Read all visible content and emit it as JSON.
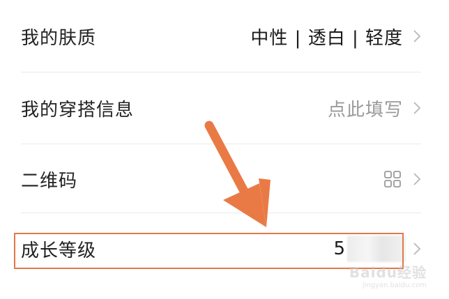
{
  "rows": [
    {
      "label": "我的肤质",
      "value": "中性 | 透白 | 轻度"
    },
    {
      "label": "我的穿搭信息",
      "value": "点此填写"
    },
    {
      "label": "二维码",
      "value_icon": "qr-code-icon"
    },
    {
      "label": "成长等级",
      "value": "5"
    }
  ],
  "colors": {
    "highlight": "#e4774a",
    "arrow": "#ea7a45",
    "muted_text": "#9a9a9a",
    "divider": "#e9e9e9"
  },
  "watermark": {
    "main": "Baidu经验",
    "sub": "jingyan.baidu.com"
  }
}
